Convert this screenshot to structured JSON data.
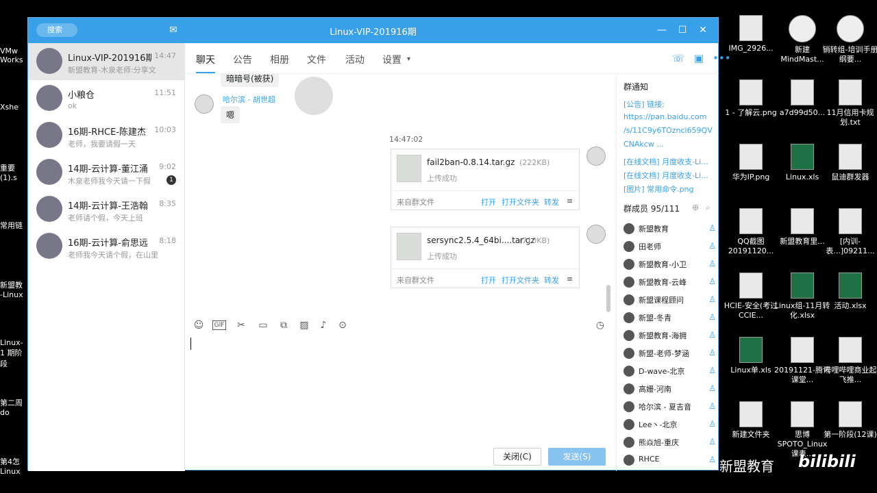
{
  "window": {
    "title": "Linux-VIP-201916期",
    "search_placeholder": "搜索"
  },
  "conversations": [
    {
      "name": "Linux-VIP-201916期",
      "time": "14:47",
      "msg": "新盟教育-木泉老师:分享文",
      "active": true
    },
    {
      "name": "小粮仓",
      "time": "11:51",
      "msg": "ok"
    },
    {
      "name": "16期-RHCE-陈建杰",
      "time": "10:03",
      "msg": "老师，我要请假一天"
    },
    {
      "name": "14期-云计算-董江涌",
      "time": "9:02",
      "msg": "木泉老师我今天请一下假",
      "badge": "1"
    },
    {
      "name": "14期-云计算-王浩翰",
      "time": "8:35",
      "msg": "老师请个假，今天上班"
    },
    {
      "name": "16期-云计算-俞思远",
      "time": "8:18",
      "msg": "老师我今天请个假，在山里"
    }
  ],
  "tabs": [
    "聊天",
    "公告",
    "相册",
    "文件",
    "活动",
    "设置"
  ],
  "chat": {
    "top_bubble": "暗暗号(被获)",
    "sender": "哈尔滨 - 胡世超",
    "sender_msg": "嗯",
    "timestamp": "14:47:02",
    "files": [
      {
        "name": "fail2ban-0.8.14.tar.gz",
        "size": "(222KB)",
        "status": "上传成功",
        "source": "来自群文件",
        "open": "打开",
        "open_folder": "打开文件夹",
        "forward": "转发"
      },
      {
        "name": "sersync2.5.4_64bi....tar.gz",
        "size": "(710KB)",
        "status": "上传成功",
        "source": "来自群文件",
        "open": "打开",
        "open_folder": "打开文件夹",
        "forward": "转发"
      }
    ]
  },
  "buttons": {
    "close": "关闭(C)",
    "send": "发送(S)"
  },
  "right_panel": {
    "notice_title": "群通知",
    "notices": [
      "[公告] 链接:",
      "https://pan.baidu.com",
      "/s/11C9y6TOzncl659QV",
      "CNAkcw ...",
      "[在线文档] 月度收支-Li...",
      "[在线文档] 月度收支-Li...",
      "[图片] 常用命令.png"
    ],
    "members_title": "群成员 95/111",
    "members": [
      "新盟教育",
      "田老师",
      "新盟教育-小卫",
      "新盟教育-云峰",
      "新盟课程顾问",
      "新盟-冬青",
      "新盟教育-海拥",
      "新盟-老师-梦涵",
      "D-wave-北京",
      "高姗-河南",
      "哈尔滨 - 夏吉音",
      "Lee丶-北京",
      "熊焱旭-重庆",
      "RHCE"
    ]
  },
  "desktop_icons": [
    {
      "label": "IMG_2926...",
      "type": "img"
    },
    {
      "label": "新建 MindMast...",
      "type": "round"
    },
    {
      "label": "销转组-培训手册纲要...",
      "type": "round"
    },
    {
      "label": "1 - 了解云.png",
      "type": "img"
    },
    {
      "label": "a7d99d50...",
      "type": "img"
    },
    {
      "label": "11月信用卡规划.txt",
      "type": "img"
    },
    {
      "label": "华为IP.png",
      "type": "img"
    },
    {
      "label": "Linux.xls",
      "type": "xls"
    },
    {
      "label": "鼠迪群发器",
      "type": "img"
    },
    {
      "label": "QQ截图 20191120...",
      "type": "img"
    },
    {
      "label": "新盟教育里...",
      "type": "img"
    },
    {
      "label": "[内训-表...]09211...",
      "type": "img"
    },
    {
      "label": "HCIE-安全(考过CCIE...",
      "type": "img"
    },
    {
      "label": "Linux组-11月转化.xlsx",
      "type": "xls"
    },
    {
      "label": "活动.xlsx",
      "type": "xls"
    },
    {
      "label": "Linux单.xls",
      "type": "xls"
    },
    {
      "label": "20191121-腾讯课堂...",
      "type": "img"
    },
    {
      "label": "哔哩哔哩商业起飞推...",
      "type": "img"
    },
    {
      "label": "新建文件夹",
      "type": "img"
    },
    {
      "label": "思博SPOTO_Linux课表...",
      "type": "img"
    },
    {
      "label": "第一阶段(12课)",
      "type": "img"
    }
  ],
  "left_strip": [
    "VMw Works",
    "Xshe",
    "重要(1).s",
    "常用链",
    "新盟教 -Linux",
    "Linux-1 期阶段",
    "第二周 do",
    "第4怎 Linux"
  ],
  "watermark": "新盟教育",
  "watermark_logo": "bilibili",
  "colors": {
    "accent": "#37a0e9"
  }
}
